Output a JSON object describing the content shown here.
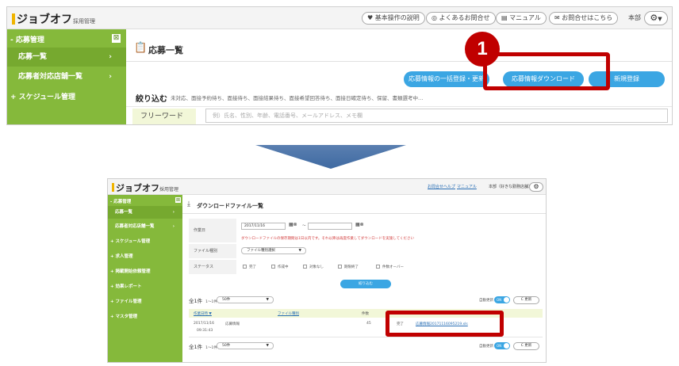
{
  "top": {
    "logo": {
      "name": "ジョブオフ",
      "sub": "採用管理"
    },
    "header_links": [
      {
        "label": "♥ 基本操作の説明"
      },
      {
        "label": "◎ よくあるお問合せ"
      },
      {
        "label": "▤ マニュアル"
      },
      {
        "label": "✉ お問合せはこちら"
      }
    ],
    "user": "本部",
    "sidebar": [
      {
        "label": "- 応募管理"
      },
      {
        "label": "応募一覧",
        "arrow": "›"
      },
      {
        "label": "応募者対応店舗一覧",
        "arrow": "›"
      },
      {
        "label": "+ スケジュール管理"
      }
    ],
    "page_title": "応募一覧",
    "buttons": [
      {
        "label": "応募情報の一括登録・更新"
      },
      {
        "label": "応募情報ダウンロード"
      },
      {
        "label": "新規登録"
      }
    ],
    "filter": {
      "label": "絞り込む",
      "statuses": "未対応、面接予約待ち、面接待ち、面接結果待ち、面接希望回答待ち、面接日確定待ち、保留、書類選考中…"
    },
    "freeword": {
      "label": "フリーワード",
      "placeholder": "例）氏名、性別、年齢、電話番号、メールアドレス、メモ欄"
    },
    "step_badge": "1"
  },
  "bottom": {
    "logo": {
      "name": "ジョブオフ",
      "sub": "採用管理"
    },
    "header_links": [
      {
        "label": "お問合せ"
      },
      {
        "label": "ヘルプ"
      },
      {
        "label": "マニュアル"
      }
    ],
    "user": "本部（好きな勤務店舗）",
    "sidebar": [
      {
        "label": "- 応募管理"
      },
      {
        "label": "応募一覧",
        "arrow": "›"
      },
      {
        "label": "応募者対応店舗一覧",
        "arrow": "›"
      },
      {
        "label": "+ スケジュール管理"
      },
      {
        "label": "+ 求人管理"
      },
      {
        "label": "+ 掲載開始依頼管理"
      },
      {
        "label": "+ 効果レポート"
      },
      {
        "label": "+ ファイル管理"
      },
      {
        "label": "+ マスタ管理"
      }
    ],
    "page_title": "ダウンロードファイル一覧",
    "form": {
      "date_label": "作業日",
      "date_from": "2017/11/16",
      "date_sep": "～",
      "date_to": "",
      "note": "ダウンロードファイルの保存期間は1日以内です。それ以降は再度作業してダウンロードを実施してください",
      "file_type_label": "ファイル種別",
      "file_type_value": "ファイル種別選択",
      "status_label": "ステータス",
      "statuses": [
        "完了",
        "作成中",
        "対象なし",
        "期限終了",
        "件数オーバー"
      ],
      "search_button": "絞り込む"
    },
    "list": {
      "count": "全1件",
      "range": "1～1件を表示",
      "per_page": "50件",
      "auto_label": "自動更新",
      "toggle": "ON",
      "refresh": "C 更新"
    },
    "table": {
      "headers": [
        "作業日時 ▼",
        "ファイル種別",
        "件数",
        ""
      ],
      "rows": [
        {
          "date": "2017/11/16",
          "time": "09:31:43",
          "type": "応募情報",
          "count": "45",
          "status": "完了",
          "file": "応募情報20171116095219.xls"
        }
      ]
    }
  }
}
